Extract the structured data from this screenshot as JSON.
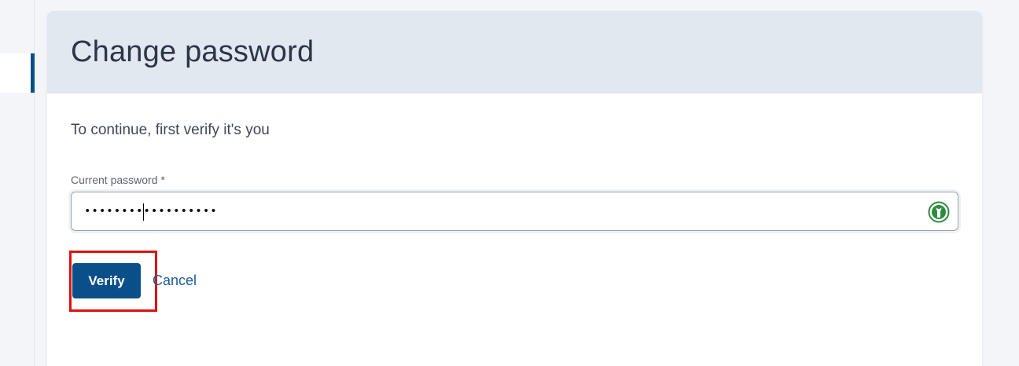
{
  "page": {
    "title": "Change password",
    "verify_text": "To continue, first verify it's you"
  },
  "form": {
    "password_label": "Current password *",
    "password_value": "••••••••••••••••••"
  },
  "actions": {
    "verify_label": "Verify",
    "cancel_label": "Cancel"
  },
  "colors": {
    "primary": "#0b4f8a",
    "header_bg": "#e2e8f0",
    "highlight": "#e01010",
    "password_manager_icon": "#2e8b3d"
  },
  "icons": {
    "password_manager": "password-manager-icon"
  }
}
